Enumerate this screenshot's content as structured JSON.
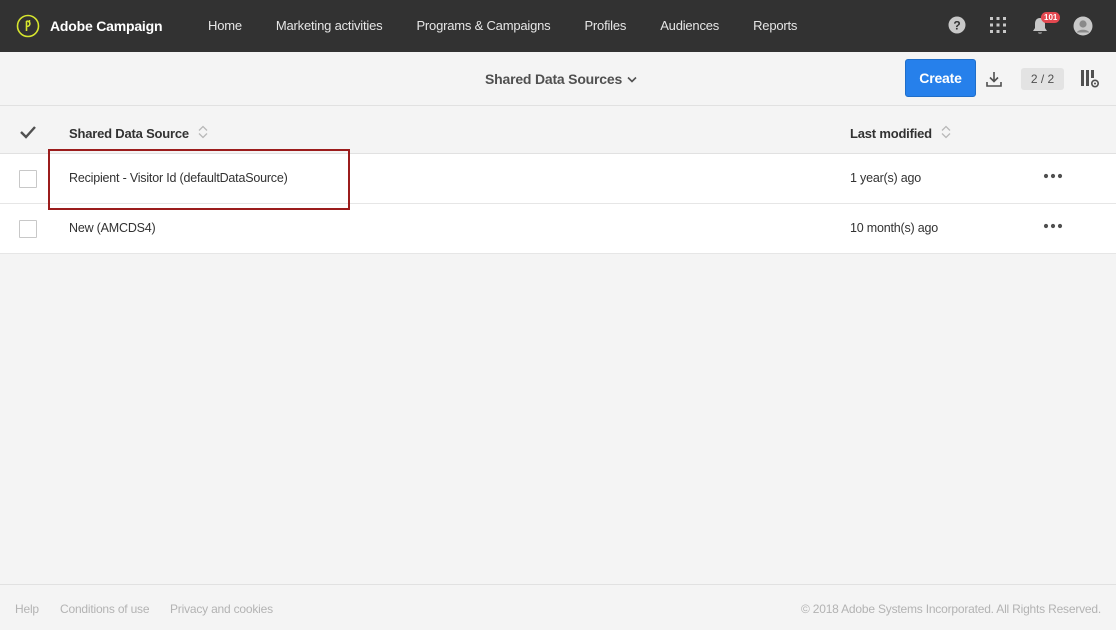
{
  "app": {
    "name": "Adobe Campaign"
  },
  "nav": {
    "items": [
      {
        "label": "Home"
      },
      {
        "label": "Marketing activities"
      },
      {
        "label": "Programs & Campaigns"
      },
      {
        "label": "Profiles"
      },
      {
        "label": "Audiences"
      },
      {
        "label": "Reports"
      }
    ]
  },
  "top_icons": {
    "help": "help-icon",
    "apps": "apps-grid-icon",
    "notifications": "bell-icon",
    "notification_count": "101",
    "avatar": "avatar-icon"
  },
  "toolbar": {
    "view_title": "Shared Data Sources",
    "create_label": "Create",
    "count": "2 / 2"
  },
  "table": {
    "columns": [
      {
        "label": "Shared Data Source"
      },
      {
        "label": "Last modified"
      }
    ],
    "rows": [
      {
        "name": "Recipient - Visitor Id (defaultDataSource)",
        "modified": "1 year(s) ago",
        "highlighted": true
      },
      {
        "name": "New (AMCDS4)",
        "modified": "10 month(s) ago",
        "highlighted": false
      }
    ]
  },
  "footer": {
    "links": [
      "Help",
      "Conditions of use",
      "Privacy and cookies"
    ],
    "copyright": "© 2018 Adobe Systems Incorporated. All Rights Reserved."
  },
  "colors": {
    "topbar": "#323232",
    "accent": "#2680eb",
    "highlight_border": "#9b1c1c",
    "badge": "#e34850"
  }
}
